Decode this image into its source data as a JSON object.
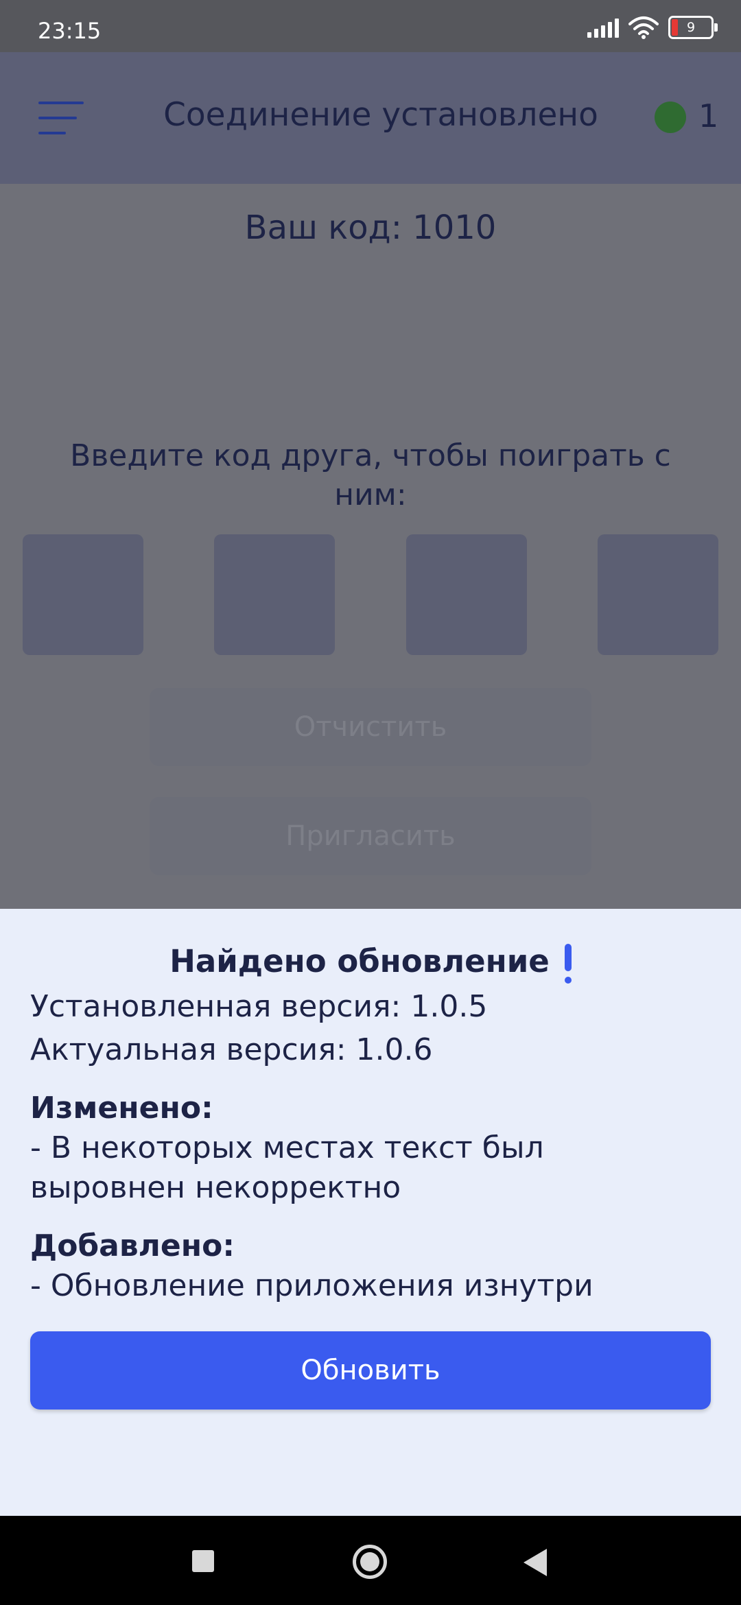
{
  "status_bar": {
    "time": "23:15",
    "battery_level": "9",
    "icons": [
      "signal-icon",
      "wifi-icon",
      "battery-icon"
    ]
  },
  "app_bar": {
    "menu_icon": "menu-icon",
    "title": "Соединение установлено",
    "connection_status_color": "#2f6b31",
    "connection_count": "1"
  },
  "main": {
    "your_code": "Ваш код: 1010",
    "friend_code_prompt": "Введите код друга, чтобы поиграть с ним:",
    "code_digits": [
      "",
      "",
      "",
      ""
    ],
    "clear_button": "Отчистить",
    "invite_button": "Пригласить"
  },
  "update_sheet": {
    "title": "Найдено обновление",
    "installed_version": "Установленная версия: 1.0.5",
    "current_version": "Актуальная версия: 1.0.6",
    "changed_heading": "Изменено:",
    "changed_line_1": "- В некоторых местах текст был",
    "changed_line_2": "выровнен некорректно",
    "added_heading": "Добавлено:",
    "added_line_1": "- Обновление приложения изнутри",
    "update_button": "Обновить",
    "accent_color": "#3a5bef"
  },
  "nav_bar": {
    "icons": [
      "recents-icon",
      "home-icon",
      "back-icon"
    ]
  }
}
